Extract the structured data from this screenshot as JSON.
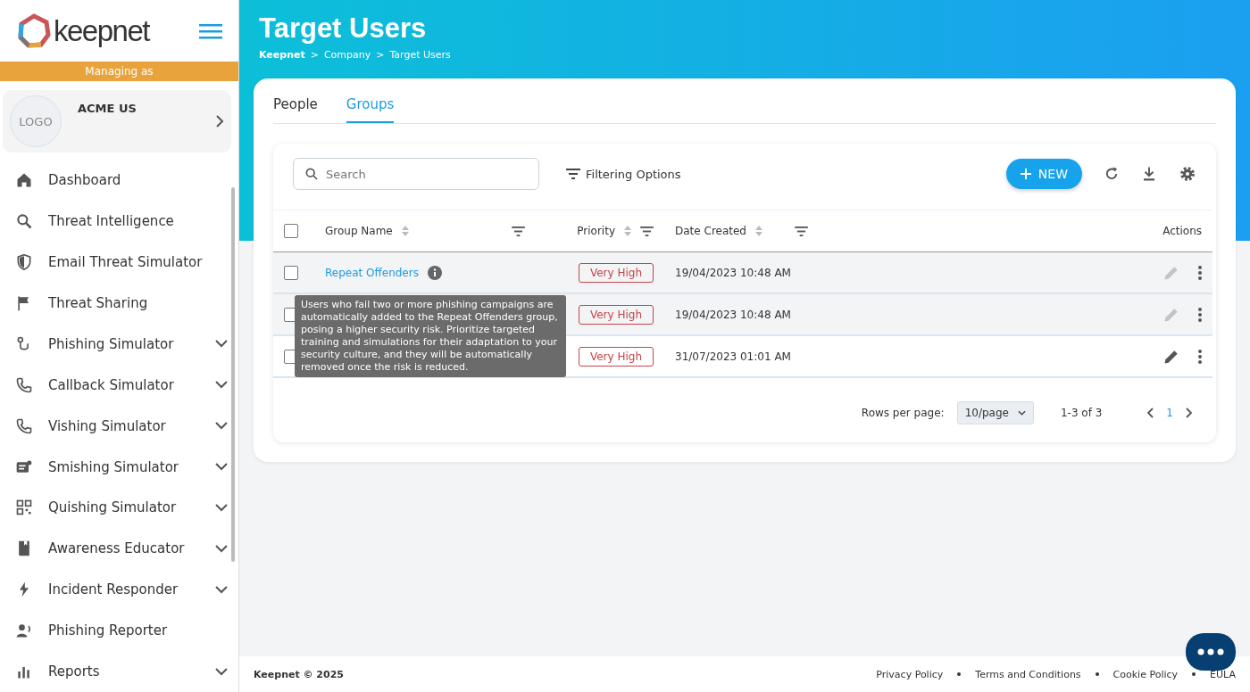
{
  "sidebar": {
    "logo_text": "keepnet",
    "managing_label": "Managing as",
    "account": {
      "logo": "LOGO",
      "name": "ACME US"
    },
    "items": [
      {
        "label": "Dashboard",
        "expandable": false
      },
      {
        "label": "Threat Intelligence",
        "expandable": false
      },
      {
        "label": "Email Threat Simulator",
        "expandable": false
      },
      {
        "label": "Threat Sharing",
        "expandable": false
      },
      {
        "label": "Phishing Simulator",
        "expandable": true
      },
      {
        "label": "Callback Simulator",
        "expandable": true
      },
      {
        "label": "Vishing Simulator",
        "expandable": true
      },
      {
        "label": "Smishing Simulator",
        "expandable": true
      },
      {
        "label": "Quishing Simulator",
        "expandable": true
      },
      {
        "label": "Awareness Educator",
        "expandable": true
      },
      {
        "label": "Incident Responder",
        "expandable": true
      },
      {
        "label": "Phishing Reporter",
        "expandable": false
      },
      {
        "label": "Reports",
        "expandable": true
      }
    ]
  },
  "page": {
    "title": "Target Users",
    "breadcrumb": [
      "Keepnet",
      "Company",
      "Target Users"
    ],
    "breadcrumb_separator": ">"
  },
  "tabs": [
    {
      "label": "People",
      "selected": false
    },
    {
      "label": "Groups",
      "selected": true
    }
  ],
  "toolbar": {
    "search": {
      "placeholder": "Search"
    },
    "filter": "Filtering Options",
    "new_button": "NEW"
  },
  "table": {
    "select_all_checked": false,
    "columns": [
      "Group Name",
      "Priority",
      "Date Created",
      "Actions"
    ],
    "rows": [
      {
        "name": "Repeat Offenders",
        "priority": "Very High",
        "date": "19/04/2023 10:48 AM",
        "checked": false,
        "highlighted": true,
        "editable": false
      },
      {
        "priority": "Very High",
        "date": "19/04/2023 10:48 AM",
        "checked": false,
        "highlighted": true,
        "editable": false
      },
      {
        "priority": "Very High",
        "date": "31/07/2023 01:01 AM",
        "checked": false,
        "highlighted": false,
        "editable": true
      }
    ],
    "tooltip": "Users who fail two or more phishing campaigns are automatically added to the Repeat Offenders group, posing a higher security risk. Prioritize targeted training and simulations for their adaptation to your security culture, and they will be automatically removed once the risk is reduced."
  },
  "pagination": {
    "rows_label": "Rows per page:",
    "page_size": "10/page",
    "range": "1-3 of 3",
    "current_page": "1"
  },
  "footer": {
    "copyright": "Keepnet © 2025",
    "links": [
      "Privacy Policy",
      "Terms and Conditions",
      "Cookie Policy",
      "EULA"
    ]
  }
}
